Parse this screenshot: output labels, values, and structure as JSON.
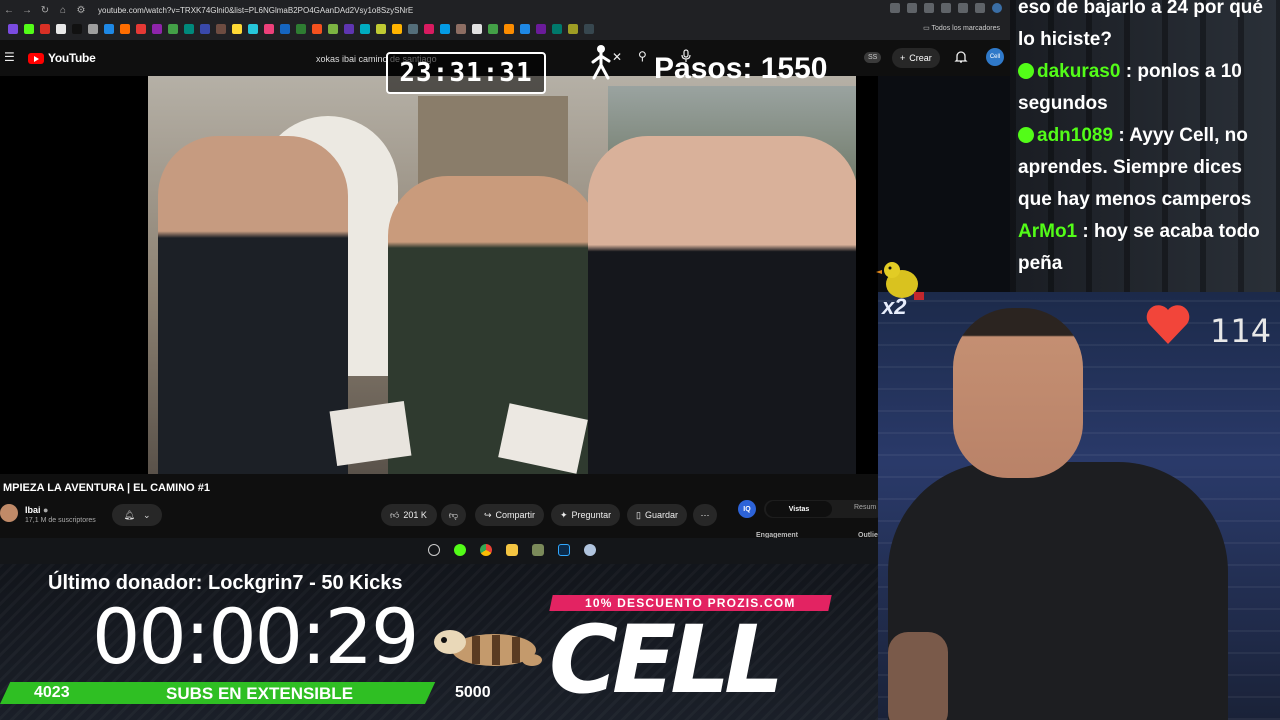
{
  "browser": {
    "url": "youtube.com/watch?v=TRXK74Glni0&list=PL6NGlmaB2PO4GAanDAd2Vsy1o8SzySNrE",
    "bookmarks_folder": "Todos los marcadores"
  },
  "youtube": {
    "logo_text": "YouTube",
    "search_value": "xokas ibai camino de santiago",
    "ss_badge": "SS",
    "create_label": "Crear",
    "avatar_text": "Cell"
  },
  "video": {
    "title": "MPIEZA LA AVENTURA | EL CAMINO #1",
    "channel_name": "Ibai",
    "channel_subs": "17,1 M de suscriptores",
    "likes": "201 K",
    "share_label": "Compartir",
    "ask_label": "Preguntar",
    "save_label": "Guardar"
  },
  "side_panel": {
    "logo_text": "IQ",
    "tab_active": "Vistas",
    "tab_other": "Resum",
    "engagement_label": "Engagement",
    "outlier_label": "Outlie"
  },
  "overlay": {
    "stream_timer": "23:31:31",
    "steps": "Pasos: 1550",
    "last_donor": "Último donador: Lockgrin7 - 50 Kicks",
    "big_timer": "00:00:29",
    "subs_current": "4023",
    "subs_label": "SUBS EN EXTENSIBLE",
    "subs_goal": "5000",
    "promo": "10% DESCUENTO PROZIS.COM",
    "brand": "CELL",
    "multiplier": "x2",
    "hearts": "114"
  },
  "chat": {
    "messages": [
      {
        "text": "eso de bajarlo a 24 por qué"
      },
      {
        "text": "lo hiciste?"
      },
      {
        "user": "dakuras0",
        "sep": " : ",
        "text": "ponlos a 10",
        "badge": true
      },
      {
        "text": "segundos"
      },
      {
        "user": "adn1089",
        "sep": " : ",
        "text": "Ayyy Cell, no",
        "badge": true
      },
      {
        "text": "aprendes. Siempre dices"
      },
      {
        "text": "que hay menos camperos"
      },
      {
        "user": "ArMo1",
        "sep": " : ",
        "text": "hoy se acaba todo",
        "badge": false
      },
      {
        "text": "peña"
      }
    ]
  },
  "colors": {
    "kick_green": "#53fc18",
    "promo_pink": "#e32362",
    "subs_bar": "#2fbf23",
    "youtube_red": "#ff0000"
  }
}
